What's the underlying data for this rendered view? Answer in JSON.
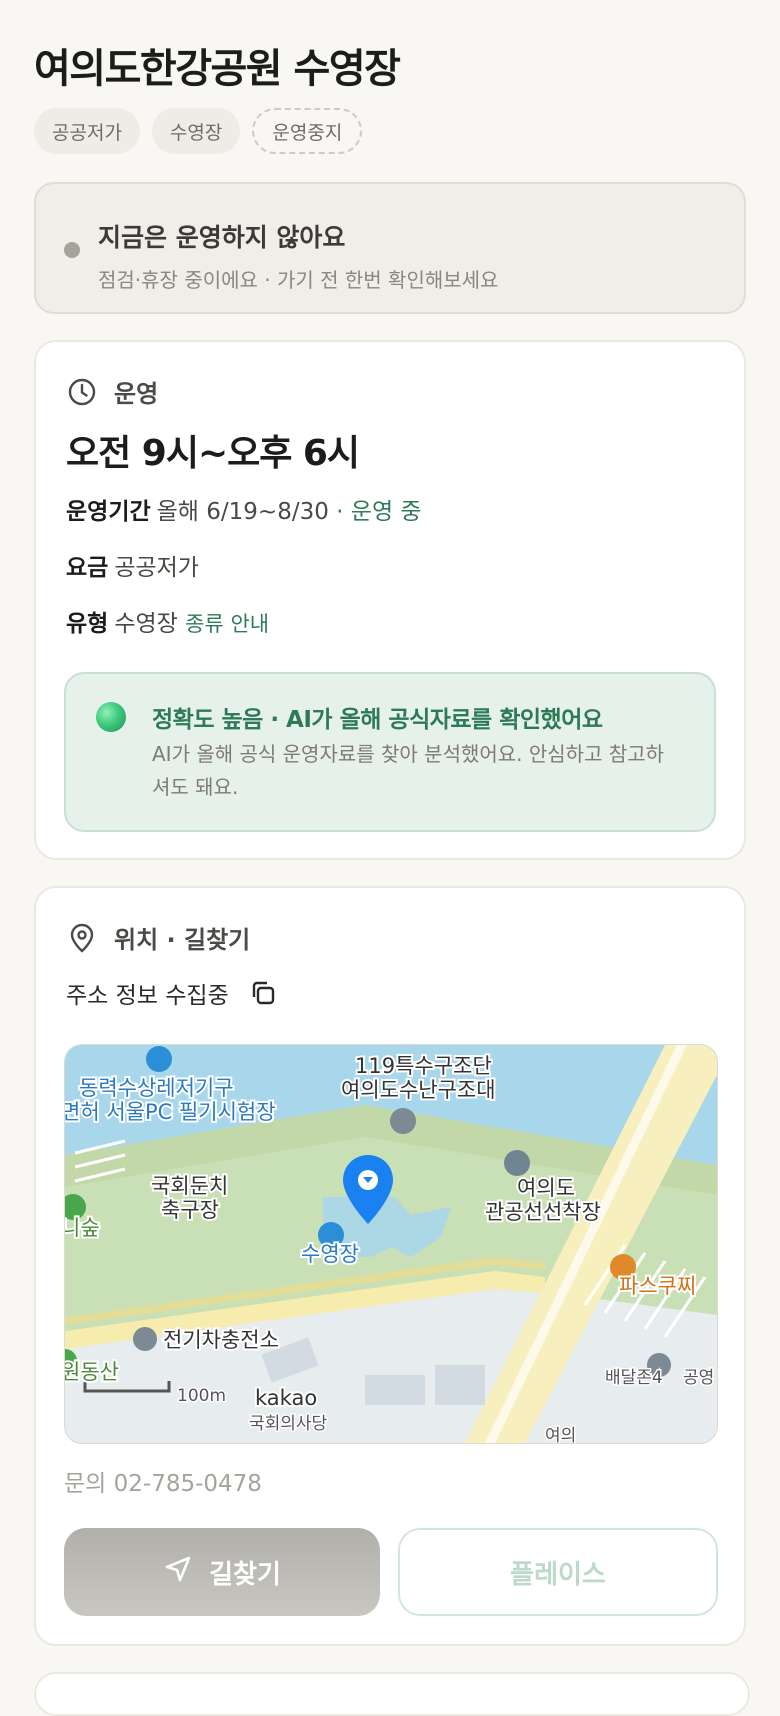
{
  "header": {
    "title": "여의도한강공원 수영장",
    "chips": [
      "공공저가",
      "수영장",
      "운영중지"
    ]
  },
  "status": {
    "title": "지금은 운영하지 않아요",
    "subtitle": "점검·휴장 중이에요 · 가기 전 한번 확인해보세요"
  },
  "operation": {
    "section_label": "운영",
    "hours": "오전 9시~오후 6시",
    "period_label": "운영기간",
    "period_value": "올해 6/19~8/30",
    "period_status": "· 운영 중",
    "fee_label": "요금",
    "fee_value": "공공저가",
    "type_label": "유형",
    "type_value": "수영장",
    "type_link": "종류 안내",
    "ai_title": "정확도 높음 · AI가 올해 공식자료를 확인했어요",
    "ai_text": "AI가 올해 공식 운영자료를 찾아 분석했어요. 안심하고 참고하셔도 돼요."
  },
  "location": {
    "section_label": "위치 · 길찾기",
    "address": "주소 정보 수집중",
    "map_labels": {
      "top_left_1": "동력수상레저기구",
      "top_left_2": "면허 서울PC 필기시험장",
      "rescue_1": "119특수구조단",
      "rescue_2": "여의도수난구조대",
      "field_1": "국회둔치",
      "field_2": "축구장",
      "forest": "니숲",
      "pool": "수영장",
      "dock_1": "여의도",
      "dock_2": "관공선선착장",
      "cafe": "파스쿠찌",
      "ev": "전기차충전소",
      "hill": "원동산",
      "scale": "100m",
      "brand": "kakao",
      "assembly": "국회의사당",
      "shop": "배달존4",
      "public": "공영",
      "road": "여의"
    },
    "phone": "문의 02-785-0478",
    "directions_button": "길찾기",
    "place_button": "플레이스"
  },
  "colors": {
    "accent_green": "#2f7a57",
    "water": "#a8d6ea",
    "park": "#c9dfb5",
    "pin": "#1a82f0"
  }
}
